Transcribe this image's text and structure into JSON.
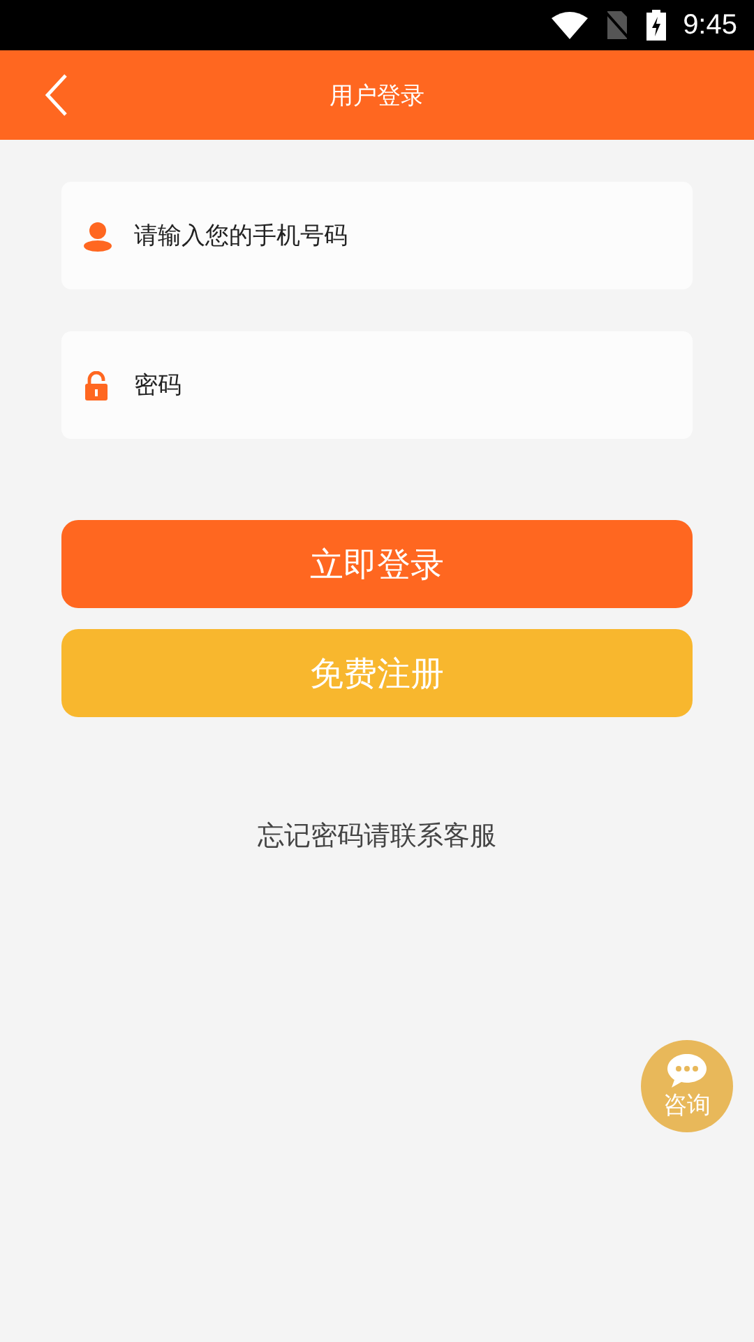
{
  "status_bar": {
    "time": "9:45"
  },
  "header": {
    "title": "用户登录"
  },
  "fields": [
    {
      "kind": "phone",
      "placeholder": "请输入您的手机号码"
    },
    {
      "kind": "password",
      "placeholder": "密码"
    }
  ],
  "buttons": [
    {
      "kind": "primary",
      "label": "立即登录"
    },
    {
      "kind": "secondary",
      "label": "免费注册"
    }
  ],
  "note": "忘记密码请联系客服",
  "consult_button": {
    "label": "咨询"
  }
}
